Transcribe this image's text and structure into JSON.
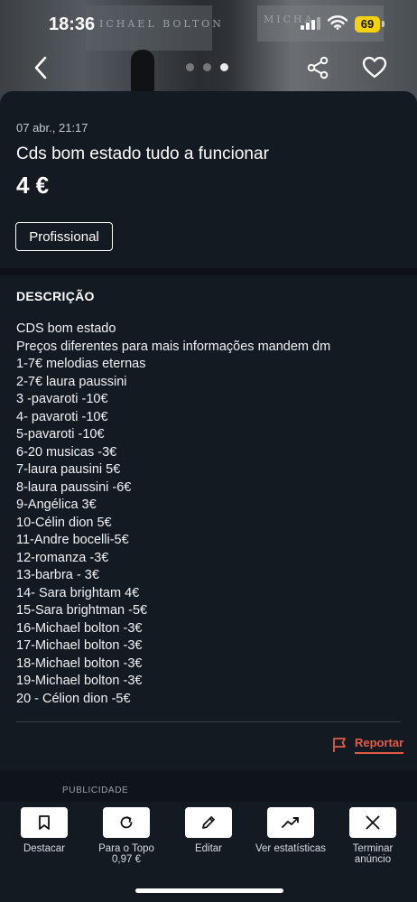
{
  "status_bar": {
    "time": "18:36",
    "battery": "69"
  },
  "hero": {
    "faint_text_left": "ICHAEL BOLTON",
    "faint_text_right": "MICHA",
    "icons": [
      "back-icon",
      "share-icon",
      "heart-icon"
    ],
    "photo_count": 3,
    "active_photo": 3
  },
  "listing": {
    "posted": "07 abr., 21:17",
    "title": "Cds bom estado tudo a funcionar",
    "price": "4 €",
    "seller_type": "Profissional"
  },
  "description": {
    "heading": "DESCRIÇÃO",
    "lines": [
      "CDS bom estado",
      "Preços diferentes para mais informações mandem dm",
      "1-7€ melodias eternas",
      "2-7€ laura paussini",
      "3 -pavaroti -10€",
      "4- pavaroti -10€",
      "5-pavaroti -10€",
      "6-20 musicas -3€",
      "7-laura pausini 5€",
      "8-laura paussini -6€",
      "9-Angélica 3€",
      "10-Célin dion 5€",
      "11-Andre bocelli-5€",
      "12-romanza -3€",
      "13-barbra - 3€",
      "14- Sara brightam 4€",
      "15-Sara brightman -5€",
      "16-Michael bolton -3€",
      "17-Michael bolton -3€",
      "18-Michael bolton -3€",
      "19-Michael bolton -3€",
      "20 - Célion dion -5€"
    ]
  },
  "report": {
    "label": "Reportar",
    "icon": "flag-icon"
  },
  "ad": {
    "label": "PUBLICIDADE"
  },
  "actions": [
    {
      "label": "Destacar",
      "sub": "",
      "icon": "bookmark-icon"
    },
    {
      "label": "Para o Topo",
      "sub": "0,97 €",
      "icon": "refresh-icon"
    },
    {
      "label": "Editar",
      "sub": "",
      "icon": "pencil-icon"
    },
    {
      "label": "Ver estatísticas",
      "sub": "",
      "icon": "trend-up-icon"
    },
    {
      "label": "Terminar",
      "sub": "anúncio",
      "icon": "close-icon"
    }
  ],
  "colors": {
    "background": "#0e131a",
    "card": "#141a22",
    "accent": "#e25b45",
    "battery": "#f5d20c"
  }
}
